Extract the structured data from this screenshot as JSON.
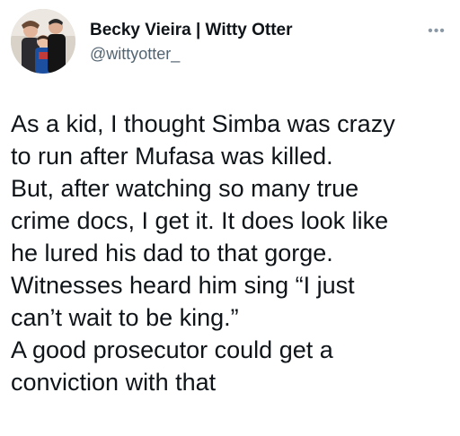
{
  "tweet": {
    "author": {
      "display_name": "Becky Vieira | Witty Otter",
      "handle": "@wittyotter_",
      "avatar_icon": "family-photo-avatar"
    },
    "more_icon": "more-options-icon",
    "text_lines": [
      "As a kid, I thought Simba was crazy",
      "to run after Mufasa was killed.",
      "But, after watching so many true",
      "crime docs, I get it. It does look like",
      "he lured his dad to that gorge.",
      "Witnesses heard him sing “I just",
      "can’t wait to be king.”",
      "A good prosecutor could get a",
      "conviction with that"
    ]
  }
}
